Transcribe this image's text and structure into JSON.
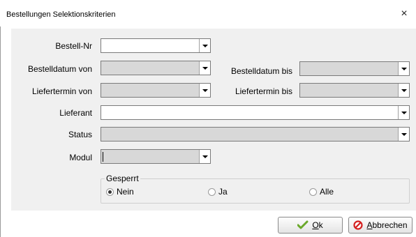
{
  "window": {
    "title": "Bestellungen Selektionskriterien",
    "close_glyph": "×"
  },
  "form": {
    "bestell_nr": {
      "label": "Bestell-Nr",
      "value": ""
    },
    "bestelldatum_von": {
      "label": "Bestelldatum von",
      "value": ""
    },
    "bestelldatum_bis": {
      "label": "Bestelldatum bis",
      "value": ""
    },
    "liefertermin_von": {
      "label": "Liefertermin von",
      "value": ""
    },
    "liefertermin_bis": {
      "label": "Liefertermin bis",
      "value": ""
    },
    "lieferant": {
      "label": "Lieferant",
      "value": ""
    },
    "status": {
      "label": "Status",
      "value": ""
    },
    "modul": {
      "label": "Modul",
      "value": ""
    }
  },
  "gesperrt": {
    "label": "Gesperrt",
    "options": [
      {
        "label": "Nein",
        "checked": true
      },
      {
        "label": "Ja",
        "checked": false
      },
      {
        "label": "Alle",
        "checked": false
      }
    ]
  },
  "buttons": {
    "ok": {
      "mnemonic": "O",
      "rest": "k",
      "icon": "checkmark-icon",
      "icon_color": "#6aa82a"
    },
    "cancel": {
      "mnemonic": "A",
      "rest": "bbrechen",
      "icon": "prohibited-icon",
      "icon_color": "#d42020"
    }
  }
}
